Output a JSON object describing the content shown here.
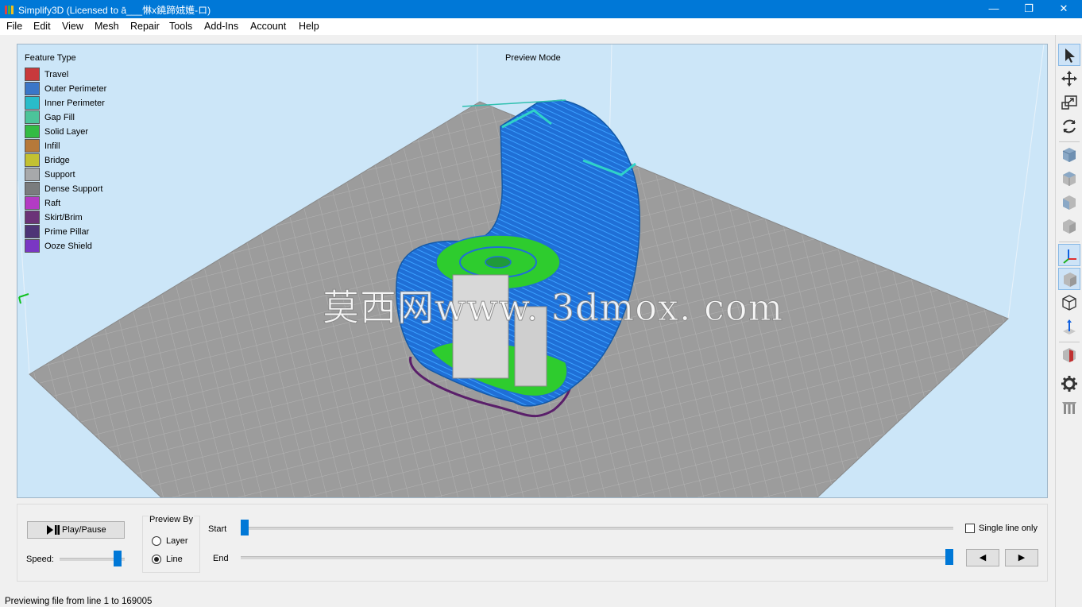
{
  "window": {
    "title": "Simplify3D (Licensed to ā___惏x鐃蹄娀嬳-ロ)",
    "minimize_glyph": "—",
    "maximize_glyph": "❐",
    "close_glyph": "✕"
  },
  "menu": [
    "File",
    "Edit",
    "View",
    "Mesh",
    "Repair",
    "Tools",
    "Add-Ins",
    "Account",
    "Help"
  ],
  "viewport": {
    "legend_title": "Feature Type",
    "mode_label": "Preview Mode",
    "watermark": "莫西网www. 3dmox. com",
    "legend": [
      {
        "label": "Travel",
        "color": "#c8393c"
      },
      {
        "label": "Outer Perimeter",
        "color": "#3a76c8"
      },
      {
        "label": "Inner Perimeter",
        "color": "#29bcca"
      },
      {
        "label": "Gap Fill",
        "color": "#4cc49a"
      },
      {
        "label": "Solid Layer",
        "color": "#33bb44"
      },
      {
        "label": "Infill",
        "color": "#b6793a"
      },
      {
        "label": "Bridge",
        "color": "#c3c132"
      },
      {
        "label": "Support",
        "color": "#a7a9ab"
      },
      {
        "label": "Dense Support",
        "color": "#7a7c7e"
      },
      {
        "label": "Raft",
        "color": "#b33bc4"
      },
      {
        "label": "Skirt/Brim",
        "color": "#6b3378"
      },
      {
        "label": "Prime Pillar",
        "color": "#4e3576"
      },
      {
        "label": "Ooze Shield",
        "color": "#7a37c4"
      }
    ]
  },
  "toolbar": [
    "select-cursor-icon",
    "move-icon",
    "scale-icon",
    "rotate-icon",
    "cube-front-view-icon",
    "cube-top-view-icon",
    "cube-left-view-icon",
    "cube-right-view-icon",
    "axes-icon",
    "solid-cube-icon",
    "wireframe-cube-icon",
    "normals-icon",
    "cross-section-icon",
    "settings-gear-icon",
    "support-pillars-icon"
  ],
  "controls": {
    "play_pause": "Play/Pause",
    "speed_label": "Speed:",
    "speed_value": 0.95,
    "preview_by_title": "Preview By",
    "layer_label": "Layer",
    "line_label": "Line",
    "preview_by_selected": "Line",
    "start_label": "Start",
    "end_label": "End",
    "start_value": 0.0,
    "end_value": 1.0,
    "single_line_label": "Single line only",
    "single_line_checked": false,
    "prev_glyph": "◀",
    "next_glyph": "▶"
  },
  "status": {
    "text": "Previewing file from line 1 to 169005"
  },
  "colors": {
    "titlebar": "#0078d7",
    "viewport_bg": "#cce6f8",
    "bed": "#9a9a9a",
    "outer_perimeter": "#1f6fd6",
    "solid_layer": "#2ecc2e"
  }
}
